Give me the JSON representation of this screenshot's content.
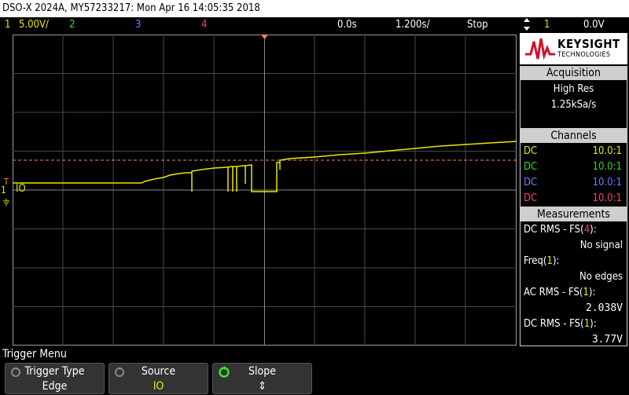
{
  "title_bar": {
    "text": "DSO-X 2024A, MY57233217: Mon Apr 16 14:05:35 2018"
  },
  "status": {
    "ch1_label": "1",
    "ch1_scale": "5.00V/",
    "ch2_label": "2",
    "ch3_label": "3",
    "ch4_label": "4",
    "time_delay": "0.0s",
    "time_scale": "1.200s/",
    "run_state": "Stop",
    "trigger_source_num": "1",
    "trigger_level": "0.0V"
  },
  "display": {
    "ground_marker": "1",
    "trigger_marker": "T",
    "channel_name": "IO",
    "trace_color": "#e8e800",
    "trigger_line_color": "#ff8a3a"
  },
  "brand": {
    "name": "KEYSIGHT",
    "sub": "TECHNOLOGIES",
    "color": "#d40f2c"
  },
  "acquisition": {
    "header": "Acquisition",
    "mode": "High Res",
    "rate": "1.25kSa/s"
  },
  "channels": {
    "header": "Channels",
    "rows": [
      {
        "coupling": "DC",
        "probe": "10.0:1",
        "color": "#e8e800"
      },
      {
        "coupling": "DC",
        "probe": "10.0:1",
        "color": "#22dd22"
      },
      {
        "coupling": "DC",
        "probe": "10.0:1",
        "color": "#6a7bff"
      },
      {
        "coupling": "DC",
        "probe": "10.0:1",
        "color": "#ff3d6e"
      }
    ]
  },
  "measurements": {
    "header": "Measurements",
    "m1": {
      "label_pre": "DC RMS - FS(",
      "src": "4",
      "label_post": "):",
      "value": "No signal",
      "src_color": "#ff3d6e"
    },
    "m2": {
      "label_pre": "Freq(",
      "src": "1",
      "label_post": "):",
      "value": "No edges",
      "src_color": "#e8e800"
    },
    "m3": {
      "label_pre": "AC RMS - FS(",
      "src": "1",
      "label_post": "):",
      "value": "2.038V",
      "src_color": "#e8e800"
    },
    "m4": {
      "label_pre": "DC RMS - FS(",
      "src": "1",
      "label_post": "):",
      "value": "3.77V",
      "src_color": "#e8e800"
    }
  },
  "softkeys": {
    "menu_title": "Trigger Menu",
    "trigger_type": {
      "label": "Trigger Type",
      "value": "Edge"
    },
    "source": {
      "label": "Source",
      "value": "IO"
    },
    "slope": {
      "label": "Slope",
      "value": "⇕"
    }
  }
}
